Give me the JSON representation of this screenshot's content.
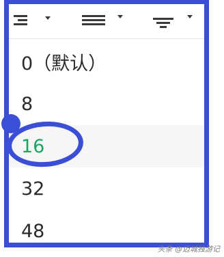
{
  "toolbar": {
    "buttons": [
      {
        "name": "line-spacing-icon"
      },
      {
        "name": "align-justify-icon"
      },
      {
        "name": "filter-list-icon"
      }
    ]
  },
  "menu": {
    "items": [
      {
        "label": "0（默认）",
        "selected": false
      },
      {
        "label": "8",
        "selected": false
      },
      {
        "label": "16",
        "selected": true
      },
      {
        "label": "32",
        "selected": false
      },
      {
        "label": "48",
        "selected": false
      }
    ]
  },
  "watermark": "头条 @迈城独游记",
  "colors": {
    "annotation_blue": "#3a4fd6",
    "selected_green": "#1aa561",
    "text": "#2b2b2b"
  }
}
